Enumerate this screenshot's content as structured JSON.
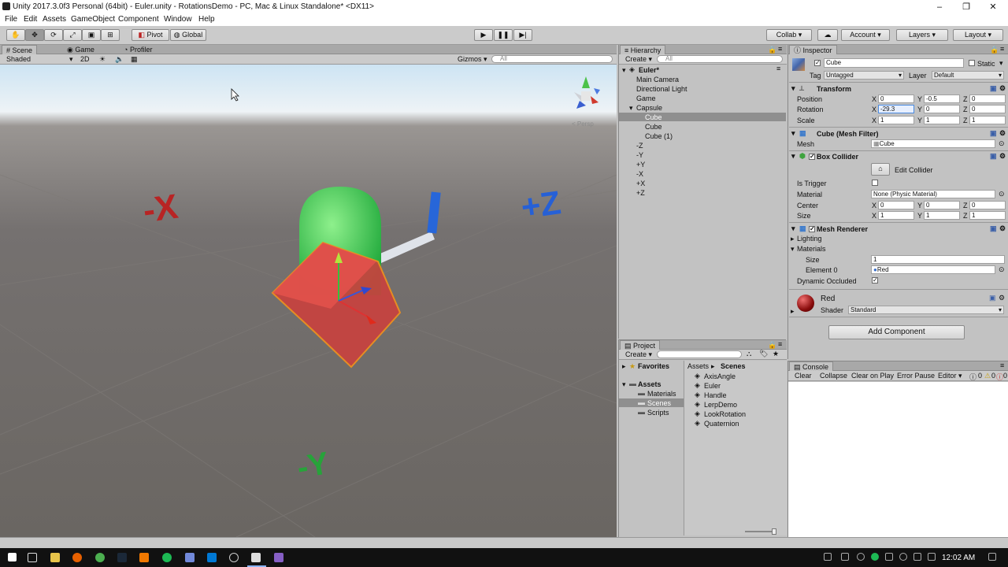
{
  "window": {
    "title": "Unity 2017.3.0f3 Personal (64bit) - Euler.unity - RotationsDemo - PC, Mac & Linux Standalone* <DX11>",
    "minimize": "–",
    "maximize": "❐",
    "close": "✕"
  },
  "menu": [
    "File",
    "Edit",
    "Assets",
    "GameObject",
    "Component",
    "Window",
    "Help"
  ],
  "toolbar": {
    "pivot": "Pivot",
    "global": "Global",
    "collab": "Collab ▾",
    "account": "Account ▾",
    "layers": "Layers ▾",
    "layout": "Layout ▾"
  },
  "scene": {
    "tabs": [
      "Scene",
      "Game",
      "Profiler"
    ],
    "shading": "Shaded",
    "mode2d": "2D",
    "gizmos": "Gizmos ▾",
    "search_placeholder": "All",
    "persp": "< Persp",
    "labels": {
      "neg_x": "-X",
      "pos_z": "+Z",
      "neg_y": "-Y"
    }
  },
  "hierarchy": {
    "tab": "Hierarchy",
    "create": "Create ▾",
    "search_placeholder": "All",
    "scene_name": "Euler*",
    "items": [
      "Main Camera",
      "Directional Light",
      "Game",
      "Capsule",
      "Cube",
      "Cube",
      "Cube (1)",
      "-Z",
      "-Y",
      "+Y",
      "-X",
      "+X",
      "+Z"
    ]
  },
  "project": {
    "tab": "Project",
    "create": "Create ▾",
    "favorites": "Favorites",
    "assets": "Assets",
    "folders": [
      "Materials",
      "Scenes",
      "Scripts"
    ],
    "breadcrumb": [
      "Assets",
      "Scenes"
    ],
    "files": [
      "AxisAngle",
      "Euler",
      "Handle",
      "LerpDemo",
      "LookRotation",
      "Quaternion"
    ]
  },
  "inspector": {
    "tab": "Inspector",
    "object_name": "Cube",
    "static": "Static",
    "tag_label": "Tag",
    "tag_value": "Untagged",
    "layer_label": "Layer",
    "layer_value": "Default",
    "transform": {
      "title": "Transform",
      "position_label": "Position",
      "rotation_label": "Rotation",
      "scale_label": "Scale",
      "position": [
        "0",
        "-0.5",
        "0"
      ],
      "rotation": [
        "-29.3",
        "0",
        "0"
      ],
      "scale": [
        "1",
        "1",
        "1"
      ]
    },
    "axes": [
      "X",
      "Y",
      "Z"
    ],
    "mesh_filter": {
      "title": "Cube (Mesh Filter)",
      "mesh_label": "Mesh",
      "mesh_value": "Cube"
    },
    "box_collider": {
      "title": "Box Collider",
      "edit": "Edit Collider",
      "is_trigger": "Is Trigger",
      "material_label": "Material",
      "material_value": "None (Physic Material)",
      "center_label": "Center",
      "center": [
        "0",
        "0",
        "0"
      ],
      "size_label": "Size",
      "size": [
        "1",
        "1",
        "1"
      ]
    },
    "mesh_renderer": {
      "title": "Mesh Renderer",
      "lighting": "Lighting",
      "materials": "Materials",
      "size_label": "Size",
      "size_value": "1",
      "element_label": "Element 0",
      "element_value": "Red",
      "dynamic_occluded": "Dynamic Occluded"
    },
    "material": {
      "name": "Red",
      "shader_label": "Shader",
      "shader_value": "Standard"
    },
    "add_component": "Add Component"
  },
  "console": {
    "tab": "Console",
    "buttons": [
      "Clear",
      "Collapse",
      "Clear on Play",
      "Error Pause",
      "Editor ▾"
    ],
    "counts": [
      "0",
      "0",
      "0"
    ]
  },
  "taskbar": {
    "time": "12:02 AM"
  }
}
